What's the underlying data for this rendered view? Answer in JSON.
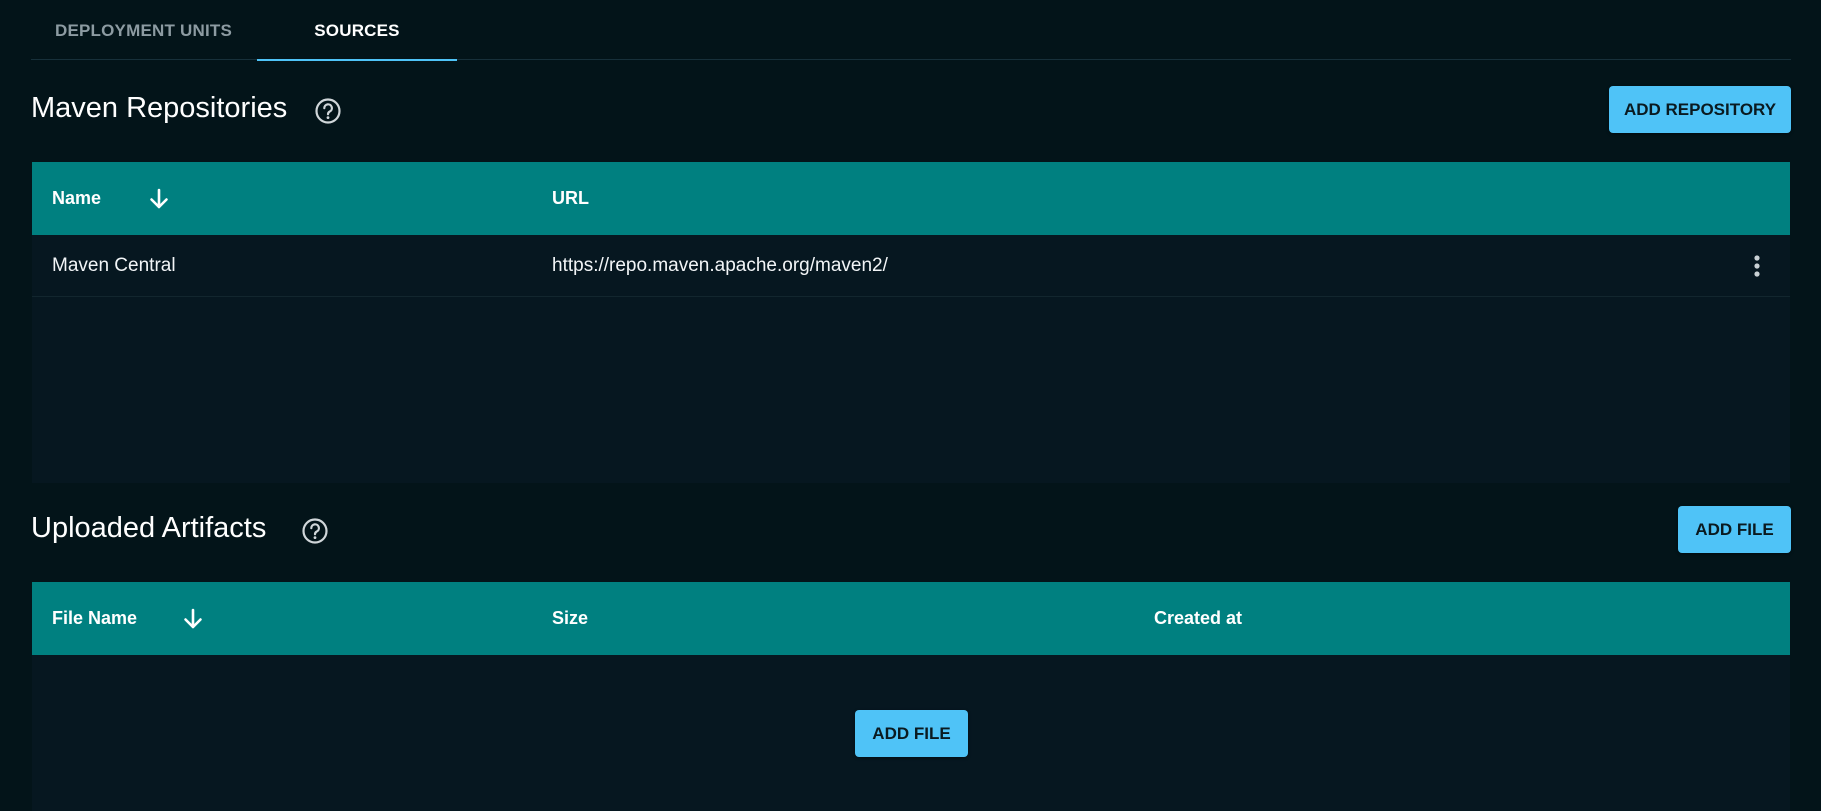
{
  "tabs": [
    {
      "label": "DEPLOYMENT UNITS"
    },
    {
      "label": "SOURCES"
    }
  ],
  "maven": {
    "title": "Maven Repositories",
    "add_button": "ADD REPOSITORY",
    "columns": {
      "name": "Name",
      "url": "URL"
    },
    "rows": [
      {
        "name": "Maven Central",
        "url": "https://repo.maven.apache.org/maven2/"
      }
    ]
  },
  "artifacts": {
    "title": "Uploaded Artifacts",
    "add_button": "ADD FILE",
    "columns": {
      "file_name": "File Name",
      "size": "Size",
      "created_at": "Created at"
    },
    "empty_add_button": "ADD FILE"
  },
  "colors": {
    "background": "#031419",
    "table_header": "#008080",
    "accent": "#4fc3f7"
  },
  "icons": {
    "help": "help-circle-icon",
    "sort": "arrow-down-icon",
    "row_menu": "more-vertical-icon"
  }
}
